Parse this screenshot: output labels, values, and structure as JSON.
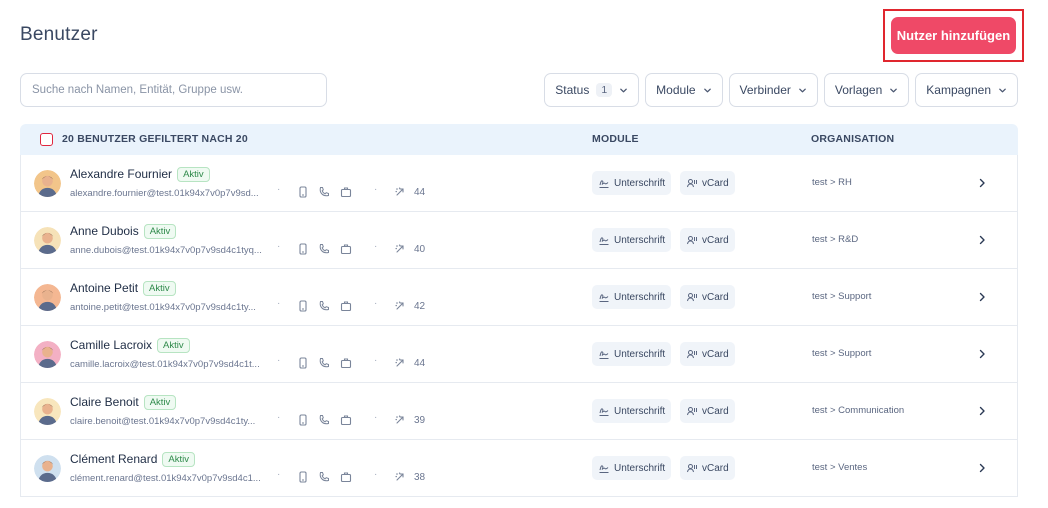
{
  "header": {
    "title": "Benutzer",
    "add_button_label": "Nutzer hinzufügen"
  },
  "search": {
    "placeholder": "Suche nach Namen, Entität, Gruppe usw.",
    "value": ""
  },
  "filters": [
    {
      "label": "Status",
      "count": "1"
    },
    {
      "label": "Module"
    },
    {
      "label": "Verbinder"
    },
    {
      "label": "Vorlagen"
    },
    {
      "label": "Kampagnen"
    }
  ],
  "table": {
    "header_users": "20 BENUTZER GEFILTERT NACH 20",
    "header_module": "MODULE",
    "header_org": "ORGANISATION",
    "rows": [
      {
        "name": "Alexandre Fournier",
        "status": "Aktiv",
        "email": "alexandre.fournier@test.01k94x7v0p7v9sd...",
        "score": "44",
        "module_1": "Unterschrift",
        "module_2": "vCard",
        "org": "test > RH",
        "avatar_color": "#f2c58a"
      },
      {
        "name": "Anne Dubois",
        "status": "Aktiv",
        "email": "anne.dubois@test.01k94x7v0p7v9sd4c1tyq...",
        "score": "40",
        "module_1": "Unterschrift",
        "module_2": "vCard",
        "org": "test > R&D",
        "avatar_color": "#f6e2b8"
      },
      {
        "name": "Antoine Petit",
        "status": "Aktiv",
        "email": "antoine.petit@test.01k94x7v0p7v9sd4c1ty...",
        "score": "42",
        "module_1": "Unterschrift",
        "module_2": "vCard",
        "org": "test > Support",
        "avatar_color": "#f4b792"
      },
      {
        "name": "Camille Lacroix",
        "status": "Aktiv",
        "email": "camille.lacroix@test.01k94x7v0p7v9sd4c1t...",
        "score": "44",
        "module_1": "Unterschrift",
        "module_2": "vCard",
        "org": "test > Support",
        "avatar_color": "#f3b0c4"
      },
      {
        "name": "Claire Benoit",
        "status": "Aktiv",
        "email": "claire.benoit@test.01k94x7v0p7v9sd4c1ty...",
        "score": "39",
        "module_1": "Unterschrift",
        "module_2": "vCard",
        "org": "test > Communication",
        "avatar_color": "#f8e6bd"
      },
      {
        "name": "Clément Renard",
        "status": "Aktiv",
        "email": "clément.renard@test.01k94x7v0p7v9sd4c1...",
        "score": "38",
        "module_1": "Unterschrift",
        "module_2": "vCard",
        "org": "test > Ventes",
        "avatar_color": "#cfe0ef"
      }
    ]
  },
  "colors": {
    "accent": "#ef4967",
    "header_bg": "#eaf3fc",
    "active_badge": "#2f8a4b"
  },
  "icons": {
    "row_icons": [
      "phone-icon",
      "call-icon",
      "briefcase-icon",
      "link-icon"
    ],
    "module_1_icon": "signature-icon",
    "module_2_icon": "vcard-icon",
    "row_action_icon": "chevron-right-icon"
  }
}
